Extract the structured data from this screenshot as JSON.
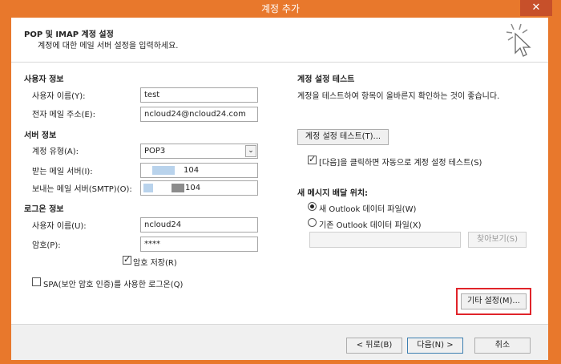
{
  "window": {
    "title": "계정 추가",
    "close_label": "✕"
  },
  "header": {
    "title": "POP 및 IMAP 계정 설정",
    "subtitle": "계정에 대한 메일 서버 설정을 입력하세요."
  },
  "user_info": {
    "section": "사용자 정보",
    "name_label": "사용자 이름(Y):",
    "name_value": "test",
    "email_label": "전자 메일 주소(E):",
    "email_value": "ncloud24@ncloud24.com"
  },
  "server_info": {
    "section": "서버 정보",
    "type_label": "계정 유형(A):",
    "type_value": "POP3",
    "incoming_label": "받는 메일 서버(I):",
    "incoming_value": "104",
    "outgoing_label": "보내는 메일 서버(SMTP)(O):",
    "outgoing_value": "104"
  },
  "login_info": {
    "section": "로그온 정보",
    "user_label": "사용자 이름(U):",
    "user_value": "ncloud24",
    "password_label": "암호(P):",
    "password_value": "****",
    "remember_label": "암호 저장(R)",
    "remember_checked": true,
    "spa_label": "SPA(보안 암호 인증)를 사용한 로그온(Q)",
    "spa_checked": false
  },
  "test_settings": {
    "section": "계정 설정 테스트",
    "description": "계정을 테스트하여 항목이 올바른지 확인하는 것이 좋습니다.",
    "test_button": "계정 설정 테스트(T)...",
    "auto_test_label": "[다음]을 클릭하면 자동으로 계정 설정 테스트(S)",
    "auto_test_checked": true
  },
  "delivery": {
    "section": "새 메시지 배달 위치:",
    "new_file_label": "새 Outlook 데이터 파일(W)",
    "existing_file_label": "기존 Outlook 데이터 파일(X)",
    "selected": "new",
    "browse_button": "찾아보기(S)"
  },
  "more_settings_button": "기타 설정(M)...",
  "footer": {
    "back_button": "< 뒤로(B)",
    "next_button": "다음(N) >",
    "cancel_button": "취소"
  },
  "colors": {
    "frame": "#e8782c",
    "highlight": "#e0242a"
  }
}
